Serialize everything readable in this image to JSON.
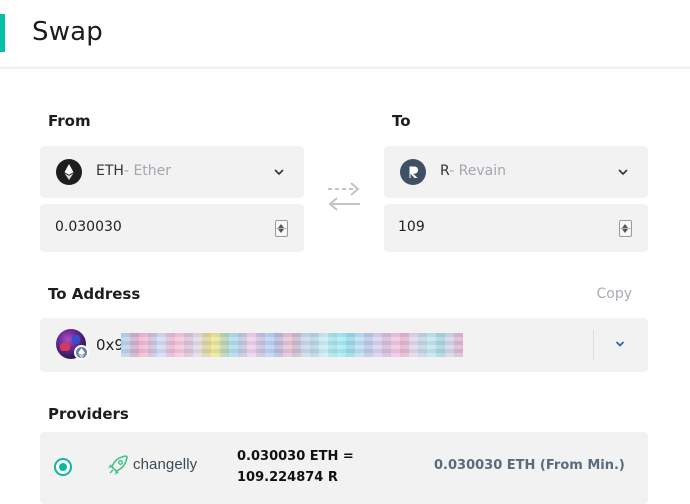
{
  "header": {
    "title": "Swap"
  },
  "from": {
    "label": "From",
    "symbol": "ETH",
    "name": "- Ether",
    "amount": "0.030030",
    "icon": "ethereum-icon"
  },
  "to": {
    "label": "To",
    "symbol": "R",
    "name": "- Revain",
    "amount": "109",
    "icon": "revain-icon"
  },
  "address": {
    "label": "To Address",
    "copy_label": "Copy",
    "prefix": "0x9",
    "icon": "avatar-identicon"
  },
  "providers": {
    "label": "Providers",
    "items": [
      {
        "name": "changelly",
        "rate_line1": "0.030030 ETH =",
        "rate_line2": "109.224874 R",
        "min": "0.030030 ETH (From Min.)",
        "selected": true
      }
    ]
  },
  "colors": {
    "accent": "#05c0a5",
    "radio": "#12b89e",
    "changelly_green": "#43c28a",
    "field_bg": "#f2f2f2"
  }
}
